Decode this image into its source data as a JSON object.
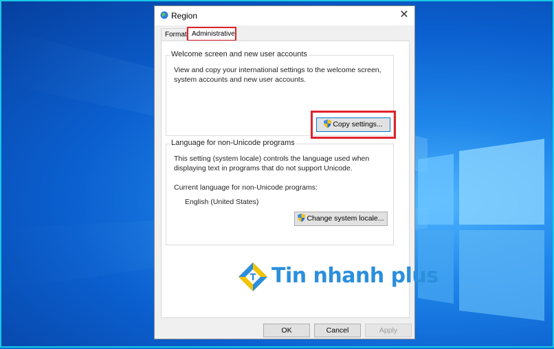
{
  "window": {
    "title": "Region",
    "close_glyph": "✕"
  },
  "tabs": [
    {
      "label": "Formats",
      "selected": false
    },
    {
      "label": "Administrative",
      "selected": true
    }
  ],
  "welcome_group": {
    "legend": "Welcome screen and new user accounts",
    "description_line1": "View and copy your international settings to the welcome screen,",
    "description_line2": "system accounts and new user accounts.",
    "copy_button": "Copy settings..."
  },
  "unicode_group": {
    "legend": "Language for non-Unicode programs",
    "description_line1": "This setting (system locale) controls the language used when",
    "description_line2": "displaying text in programs that do not support Unicode.",
    "current_label": "Current language for non-Unicode programs:",
    "current_value": "English (United States)",
    "change_button": "Change system locale..."
  },
  "footer": {
    "ok": "OK",
    "cancel": "Cancel",
    "apply": "Apply"
  },
  "watermark": {
    "text": "Tin nhanh plus",
    "letter": "T"
  },
  "colors": {
    "highlight": "#e0222b",
    "accent": "#0078d7",
    "logo_blue": "#2b8fdc",
    "logo_yellow": "#f3c400"
  }
}
